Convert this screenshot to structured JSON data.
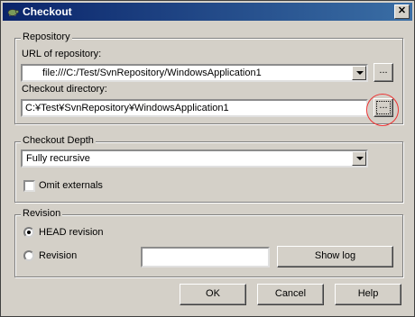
{
  "window": {
    "title": "Checkout",
    "close": "✕"
  },
  "repository": {
    "group_label": "Repository",
    "url_label": "URL of repository:",
    "url_value": "file:///C:/Test/SvnRepository/WindowsApplication1",
    "browse_url": "...",
    "dir_label": "Checkout directory:",
    "dir_value": "C:¥Test¥SvnRepository¥WindowsApplication1",
    "browse_dir": "..."
  },
  "depth": {
    "group_label": "Checkout Depth",
    "selected": "Fully recursive",
    "omit_externals": "Omit externals",
    "omit_externals_checked": false
  },
  "revision": {
    "group_label": "Revision",
    "head": "HEAD revision",
    "head_selected": true,
    "revision_option": "Revision",
    "revision_value": "",
    "show_log": "Show log"
  },
  "buttons": {
    "ok": "OK",
    "cancel": "Cancel",
    "help": "Help"
  }
}
